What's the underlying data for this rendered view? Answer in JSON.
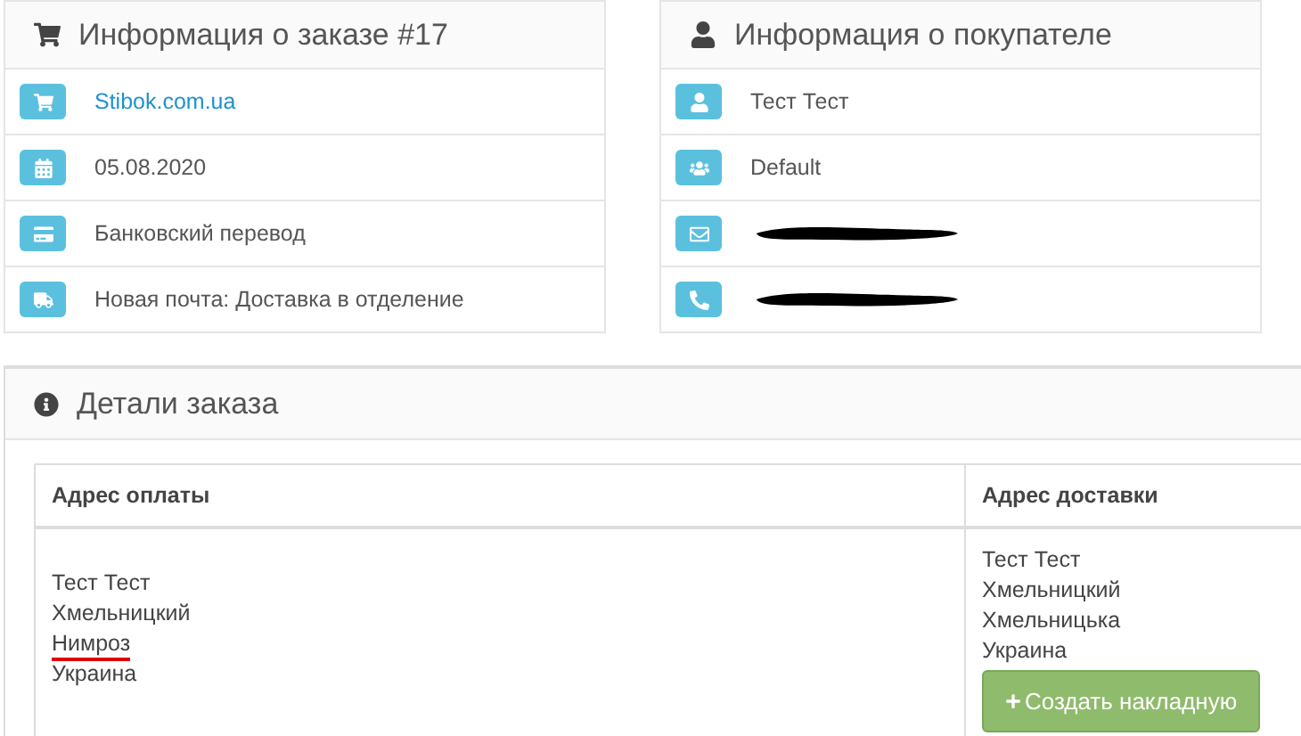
{
  "order_panel": {
    "title": "Информация о заказе #17",
    "rows": [
      {
        "text": "Stibok.com.ua",
        "link": true
      },
      {
        "text": "05.08.2020",
        "link": false
      },
      {
        "text": "Банковский перевод",
        "link": false
      },
      {
        "text": "Новая почта: Доставка в отделение",
        "link": false
      }
    ]
  },
  "customer_panel": {
    "title": "Информация о покупателе",
    "rows": [
      {
        "text": "Тест Тест",
        "redacted": false
      },
      {
        "text": "Default",
        "redacted": false
      },
      {
        "redacted": true
      },
      {
        "redacted": true
      }
    ]
  },
  "details_panel": {
    "title": "Детали заказа",
    "table": {
      "columns": [
        "Адрес оплаты",
        "Адрес доставки"
      ],
      "payment_address": [
        {
          "text": "Тест Тест",
          "underlined": false
        },
        {
          "text": "Хмельницкий",
          "underlined": false
        },
        {
          "text": "Нимроз",
          "underlined": true
        },
        {
          "text": "Украина",
          "underlined": false
        }
      ],
      "shipping_address": [
        "Тест Тест",
        "Хмельницкий",
        "Хмельницька",
        "Украина"
      ],
      "button": "Создать накладную"
    }
  }
}
